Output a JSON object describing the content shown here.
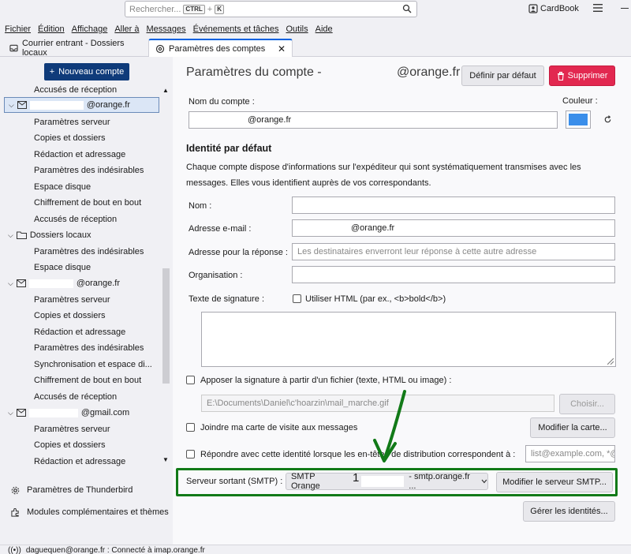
{
  "topbar": {
    "search_placeholder": "Rechercher...",
    "shortcut_ctrl": "CTRL",
    "shortcut_plus": "+",
    "shortcut_key": "K",
    "cardbook_label": "CardBook"
  },
  "menu": [
    "Fichier",
    "Édition",
    "Affichage",
    "Aller à",
    "Messages",
    "Événements et tâches",
    "Outils",
    "Aide"
  ],
  "tabs": [
    {
      "label": "Courrier entrant - Dossiers locaux"
    },
    {
      "label": "Paramètres des comptes"
    }
  ],
  "sidebar": {
    "new_account_label": "Nouveau compte",
    "items": [
      "Accusés de réception",
      "@orange.fr",
      "Paramètres serveur",
      "Copies et dossiers",
      "Rédaction et adressage",
      "Paramètres des indésirables",
      "Espace disque",
      "Chiffrement de bout en bout",
      "Accusés de réception",
      "Dossiers locaux",
      "Paramètres des indésirables",
      "Espace disque",
      "@orange.fr",
      "Paramètres serveur",
      "Copies et dossiers",
      "Rédaction et adressage",
      "Paramètres des indésirables",
      "Synchronisation et espace di...",
      "Chiffrement de bout en bout",
      "Accusés de réception",
      "@gmail.com",
      "Paramètres serveur",
      "Copies et dossiers",
      "Rédaction et adressage"
    ],
    "thunderbird_settings": "Paramètres de Thunderbird",
    "addons": "Modules complémentaires et thèmes"
  },
  "main": {
    "title": "Paramètres du compte -",
    "title_suffix": "@orange.fr",
    "default_button": "Définir par défaut",
    "delete_button": "Supprimer",
    "account_name_label": "Nom du compte :",
    "account_name_value": "@orange.fr",
    "color_label": "Couleur :",
    "identity_heading": "Identité par défaut",
    "identity_desc": "Chaque compte dispose d'informations sur l'expéditeur qui sont systématiquement transmises avec les messages. Elles vous identifient auprès de vos correspondants.",
    "name_label": "Nom :",
    "name_value": "",
    "email_label": "Adresse e-mail :",
    "email_value": "@orange.fr",
    "reply_label": "Adresse pour la réponse :",
    "reply_placeholder": "Les destinataires enverront leur réponse à cette autre adresse",
    "org_label": "Organisation :",
    "org_value": "",
    "signature_label": "Texte de signature :",
    "use_html_label": "Utiliser HTML (par ex., <b>bold</b>)",
    "sig_file_label": "Apposer la signature à partir d'un fichier (texte, HTML ou image) :",
    "sig_file_path": "E:\\Documents\\Daniel\\c'hoarzin\\mail_marche.gif",
    "choose_button": "Choisir...",
    "vcard_label": "Joindre ma carte de visite aux messages",
    "edit_card_button": "Modifier la carte...",
    "reply_identity_label": "Répondre avec cette identité lorsque les en-têtes de distribution correspondent à :",
    "reply_identity_placeholder": "list@example.com, *@",
    "smtp_label": "Serveur sortant (SMTP) :",
    "smtp_value_prefix": "SMTP Orange",
    "smtp_annotation": "1",
    "smtp_value_suffix": "- smtp.orange.fr ...",
    "smtp_edit_button": "Modifier le serveur SMTP...",
    "manage_identities_button": "Gérer les identités..."
  },
  "status": {
    "text": "daguequen@orange.fr : Connecté à imap.orange.fr"
  },
  "colors": {
    "accent": "#0f3b7a",
    "danger": "#e22850",
    "account_color": "#3a8eea",
    "annotation_green": "#127a18"
  }
}
